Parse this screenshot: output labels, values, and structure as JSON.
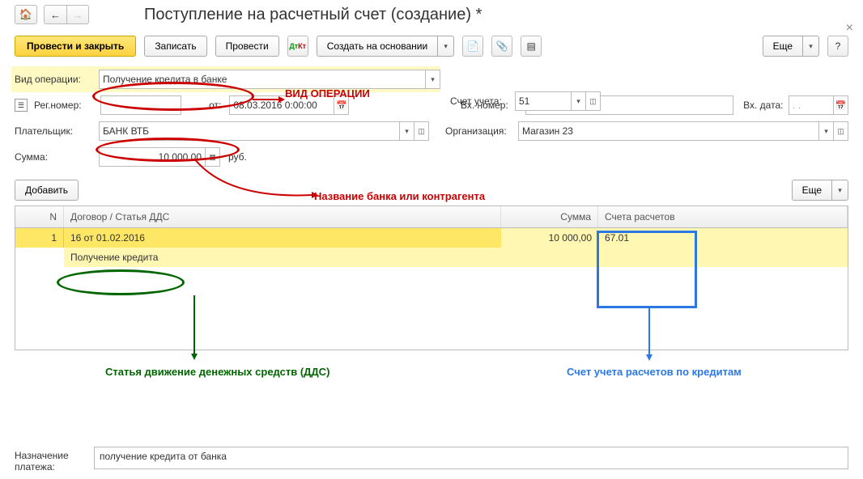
{
  "header": {
    "title": "Поступление на расчетный счет (создание) *"
  },
  "toolbar": {
    "post_close": "Провести и закрыть",
    "save": "Записать",
    "post": "Провести",
    "create_based": "Создать на основании",
    "more": "Еще"
  },
  "operation": {
    "label": "Вид операции:",
    "value": "Получение кредита в банке",
    "anno": "ВИД ОПЕРАЦИИ"
  },
  "account_field": {
    "label": "Счет учета:",
    "value": "51"
  },
  "reg": {
    "label": "Рег.номер:",
    "from_label": "от:",
    "date": "08.03.2016 0:00:00"
  },
  "incoming": {
    "label": "Вх. номер:",
    "date_label": "Вх. дата:",
    "date": ".  ."
  },
  "payer": {
    "label": "Плательщик:",
    "value": "БАНК ВТБ"
  },
  "org": {
    "label": "Организация:",
    "value": "Магазин 23"
  },
  "sum": {
    "label": "Сумма:",
    "value": "10 000,00",
    "currency": "руб."
  },
  "bank_anno": "Название банка или контрагента",
  "table_toolbar": {
    "add": "Добавить",
    "more": "Еще"
  },
  "table": {
    "headers": {
      "n": "N",
      "contract": "Договор / Статья ДДС",
      "sum": "Сумма",
      "account": "Счета расчетов"
    },
    "row": {
      "n": "1",
      "contract": "16 от 01.02.2016",
      "sub": "Получение кредита",
      "sum": "10 000,00",
      "account": "67.01"
    }
  },
  "dds_anno": "Статья движение денежных средств (ДДС)",
  "acct_anno": "Счет учета расчетов по кредитам",
  "purpose": {
    "label": "Назначение платежа:",
    "value": "получение кредита от банка"
  }
}
